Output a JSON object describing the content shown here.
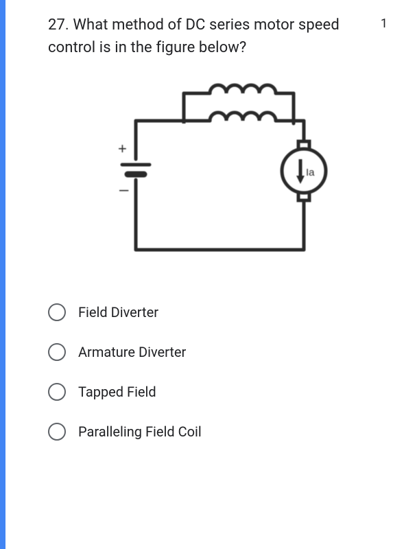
{
  "question": {
    "text": "27. What method of DC series motor speed control is in the figure below?",
    "points": "1"
  },
  "figure": {
    "battery_pos": "+",
    "battery_neg": "–",
    "armature_label": "Ia"
  },
  "options": [
    {
      "label": "Field Diverter"
    },
    {
      "label": "Armature Diverter"
    },
    {
      "label": "Tapped Field"
    },
    {
      "label": "Paralleling Field Coil"
    }
  ]
}
